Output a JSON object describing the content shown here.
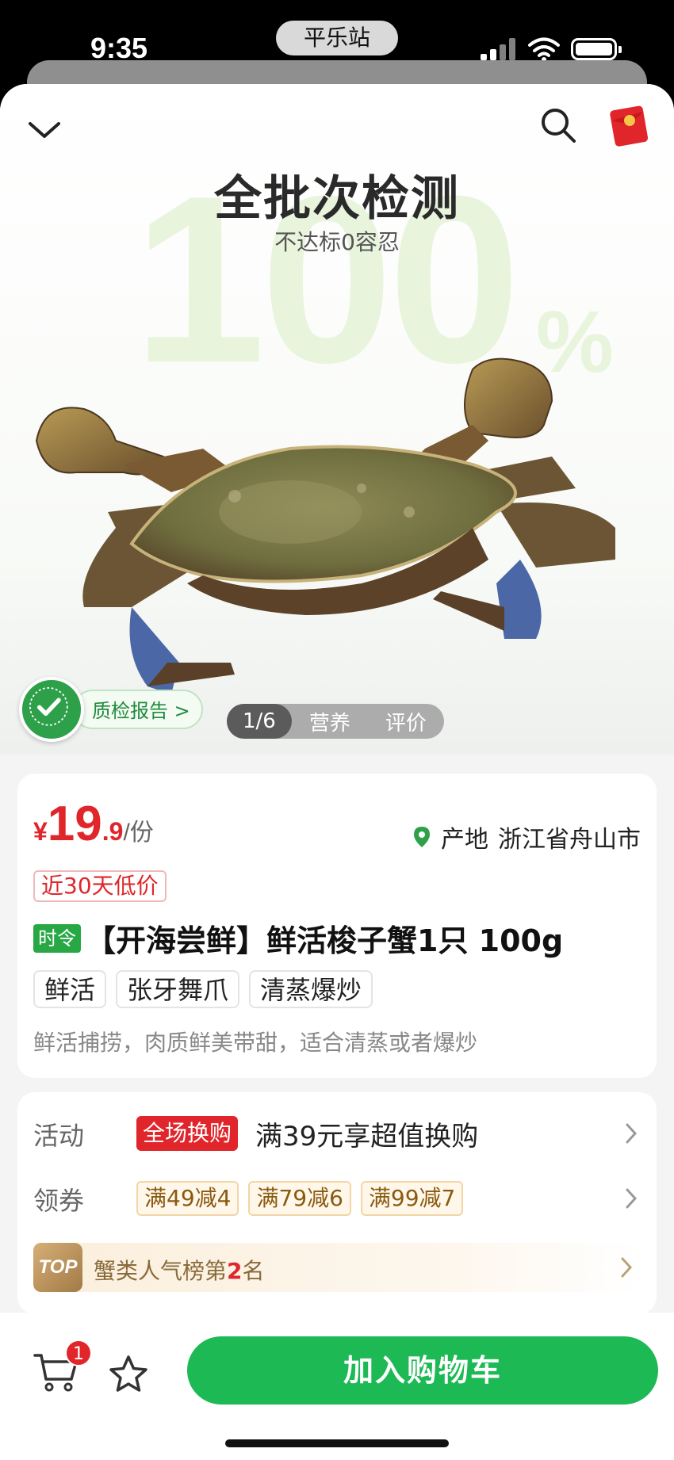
{
  "status_bar": {
    "time": "9:35",
    "carrier": "平乐站"
  },
  "hero": {
    "title": "全批次检测",
    "subtitle": "不达标0容忍",
    "bg_number": "100",
    "bg_percent": "%",
    "quality_report": "质检报告 >",
    "pager": {
      "count": "1/6",
      "tabs": [
        "营养",
        "评价"
      ]
    }
  },
  "product": {
    "price_symbol": "¥",
    "price_int": "19",
    "price_dec": ".9",
    "price_unit": "/份",
    "origin_label": "产地",
    "origin_value": "浙江省舟山市",
    "low_price_tag": "近30天低价",
    "season_tag": "时令",
    "title": "【开海尝鲜】鲜活梭子蟹1只 100g",
    "tags": [
      "鲜活",
      "张牙舞爪",
      "清蒸爆炒"
    ],
    "description": "鲜活捕捞，肉质鲜美带甜，适合清蒸或者爆炒"
  },
  "promo": {
    "activity_label": "活动",
    "activity_tag": "全场换购",
    "activity_text": "满39元享超值换购",
    "coupon_label": "领券",
    "coupons": [
      "满49减4",
      "满79减6",
      "满99减7"
    ],
    "rank_badge": "TOP",
    "rank_prefix": "蟹类人气榜第",
    "rank_number": "2",
    "rank_suffix": "名"
  },
  "bottom_bar": {
    "cart_count": "1",
    "add_to_cart": "加入购物车"
  },
  "colors": {
    "brand_green": "#1db954",
    "price_red": "#e0262b"
  }
}
